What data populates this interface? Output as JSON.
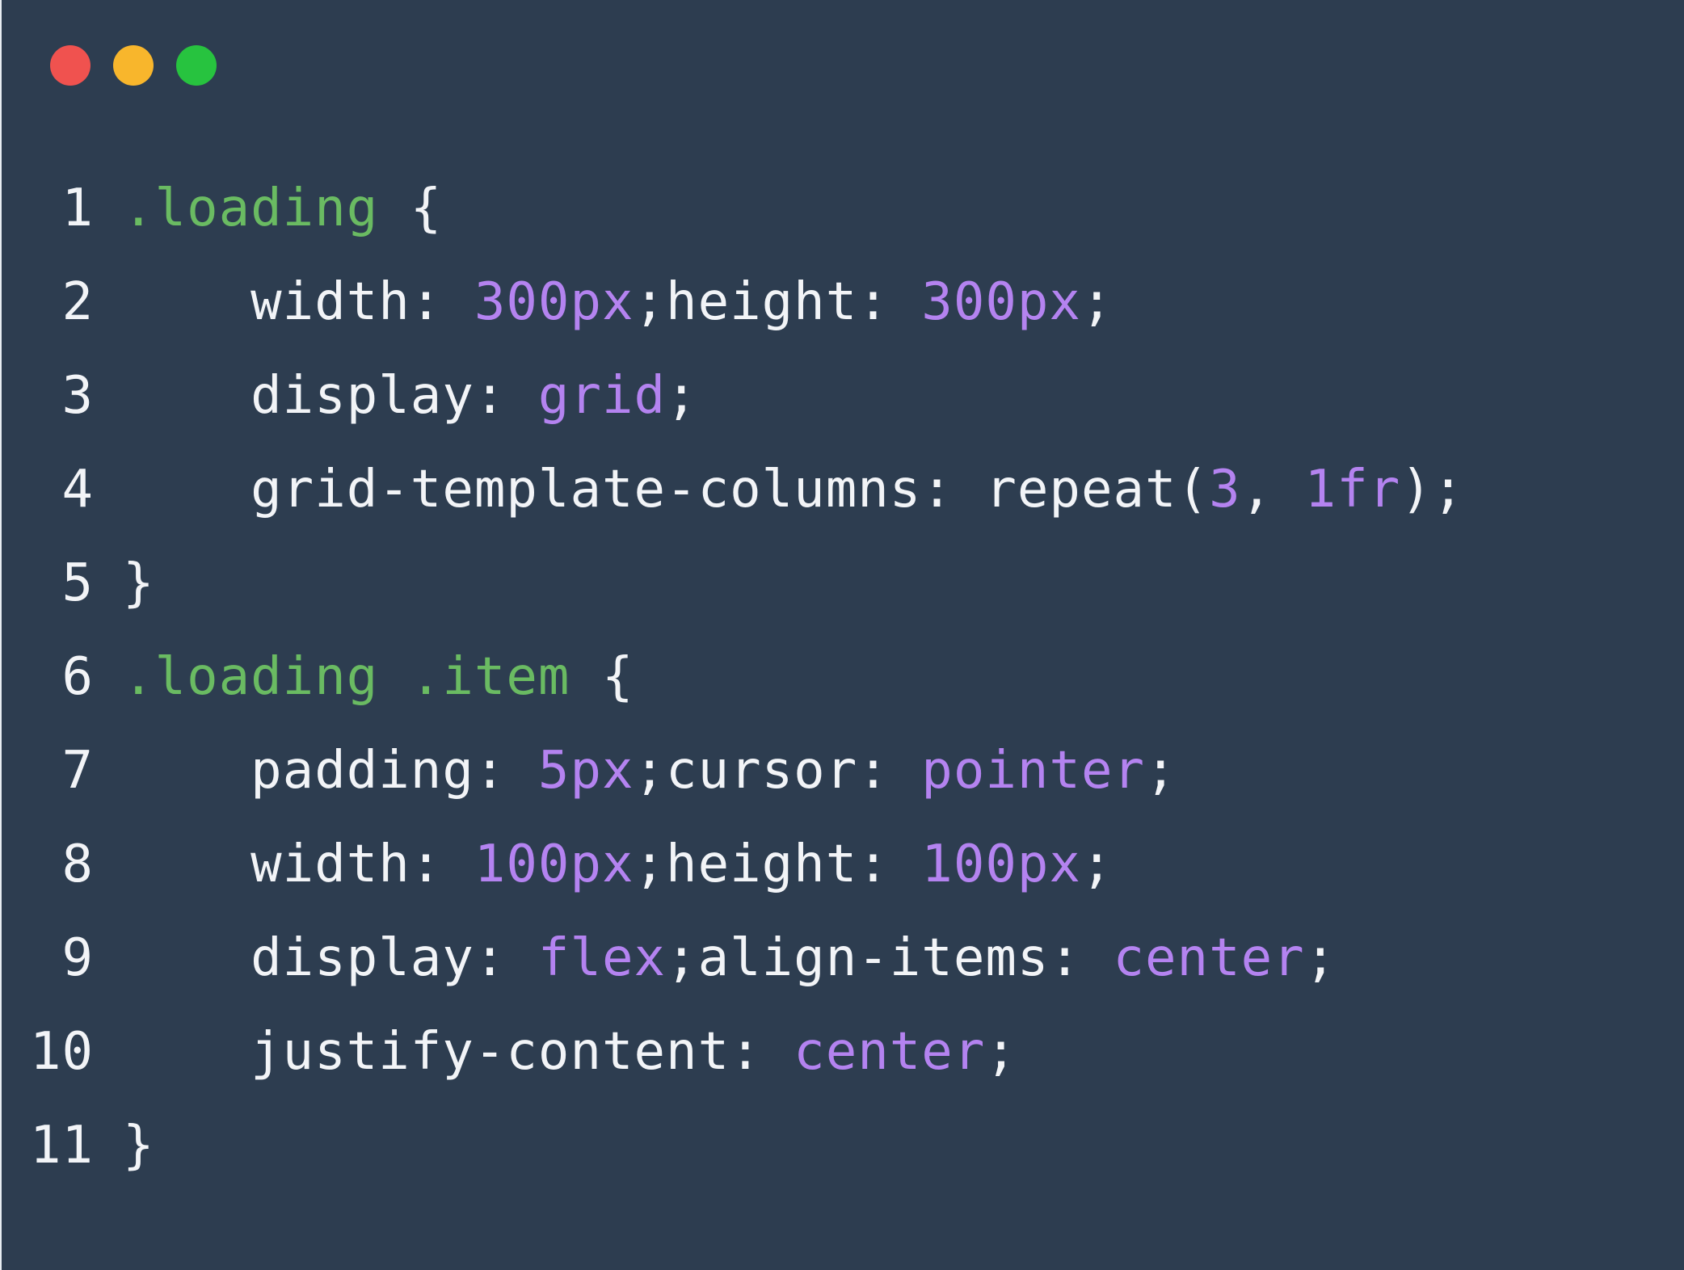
{
  "window": {
    "controls": [
      {
        "name": "close-button",
        "color": "#f0524f"
      },
      {
        "name": "minimize-button",
        "color": "#f8b62c"
      },
      {
        "name": "zoom-button",
        "color": "#27c33f"
      }
    ]
  },
  "colors": {
    "background": "#2d3d50",
    "selector": "#6abb62",
    "value": "#b483f0",
    "text": "#f2f4f7"
  },
  "code": {
    "lines": [
      {
        "number": "1",
        "tokens": [
          {
            "t": "sel",
            "v": ".loading"
          },
          {
            "t": "plain",
            "v": " {"
          }
        ]
      },
      {
        "number": "2",
        "tokens": [
          {
            "t": "plain",
            "v": "    width: "
          },
          {
            "t": "num",
            "v": "300px"
          },
          {
            "t": "plain",
            "v": ";height: "
          },
          {
            "t": "num",
            "v": "300px"
          },
          {
            "t": "plain",
            "v": ";"
          }
        ]
      },
      {
        "number": "3",
        "tokens": [
          {
            "t": "plain",
            "v": "    display: "
          },
          {
            "t": "num",
            "v": "grid"
          },
          {
            "t": "plain",
            "v": ";"
          }
        ]
      },
      {
        "number": "4",
        "tokens": [
          {
            "t": "plain",
            "v": "    grid-template-columns: repeat("
          },
          {
            "t": "num",
            "v": "3"
          },
          {
            "t": "plain",
            "v": ", "
          },
          {
            "t": "num",
            "v": "1fr"
          },
          {
            "t": "plain",
            "v": ");"
          }
        ]
      },
      {
        "number": "5",
        "tokens": [
          {
            "t": "plain",
            "v": "}"
          }
        ]
      },
      {
        "number": "6",
        "tokens": [
          {
            "t": "sel",
            "v": ".loading"
          },
          {
            "t": "plain",
            "v": " "
          },
          {
            "t": "sel",
            "v": ".item"
          },
          {
            "t": "plain",
            "v": " {"
          }
        ]
      },
      {
        "number": "7",
        "tokens": [
          {
            "t": "plain",
            "v": "    padding: "
          },
          {
            "t": "num",
            "v": "5px"
          },
          {
            "t": "plain",
            "v": ";cursor: "
          },
          {
            "t": "num",
            "v": "pointer"
          },
          {
            "t": "plain",
            "v": ";"
          }
        ]
      },
      {
        "number": "8",
        "tokens": [
          {
            "t": "plain",
            "v": "    width: "
          },
          {
            "t": "num",
            "v": "100px"
          },
          {
            "t": "plain",
            "v": ";height: "
          },
          {
            "t": "num",
            "v": "100px"
          },
          {
            "t": "plain",
            "v": ";"
          }
        ]
      },
      {
        "number": "9",
        "tokens": [
          {
            "t": "plain",
            "v": "    display: "
          },
          {
            "t": "num",
            "v": "flex"
          },
          {
            "t": "plain",
            "v": ";align-items: "
          },
          {
            "t": "num",
            "v": "center"
          },
          {
            "t": "plain",
            "v": ";"
          }
        ]
      },
      {
        "number": "10",
        "tokens": [
          {
            "t": "plain",
            "v": "    justify-content: "
          },
          {
            "t": "num",
            "v": "center"
          },
          {
            "t": "plain",
            "v": ";"
          }
        ]
      },
      {
        "number": "11",
        "tokens": [
          {
            "t": "plain",
            "v": "}"
          }
        ]
      }
    ]
  }
}
